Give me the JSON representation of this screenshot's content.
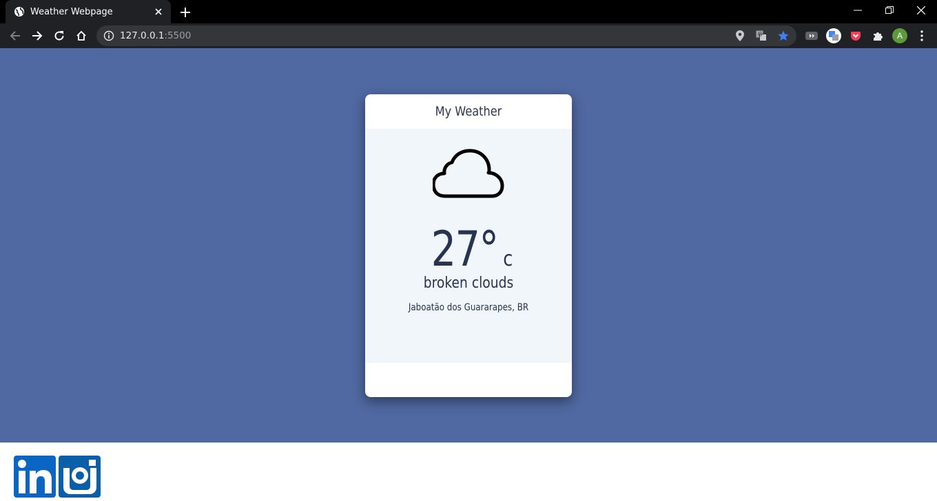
{
  "browser": {
    "tab_title": "Weather Webpage",
    "url_host": "127.0.0.1",
    "url_port": ":5500",
    "profile_initial": "A"
  },
  "card": {
    "title": "My Weather",
    "icon": "cloud-icon",
    "temperature": "27°",
    "unit": "c",
    "description": "broken clouds",
    "location": "Jaboatão dos Guararapes, BR"
  },
  "footer": {
    "links": [
      "linkedin-icon",
      "instagram-icon"
    ]
  },
  "colors": {
    "page_background": "#5069a2",
    "card_body": "#f1f6fb",
    "text": "#283253",
    "linkedin": "#0a66c2"
  }
}
